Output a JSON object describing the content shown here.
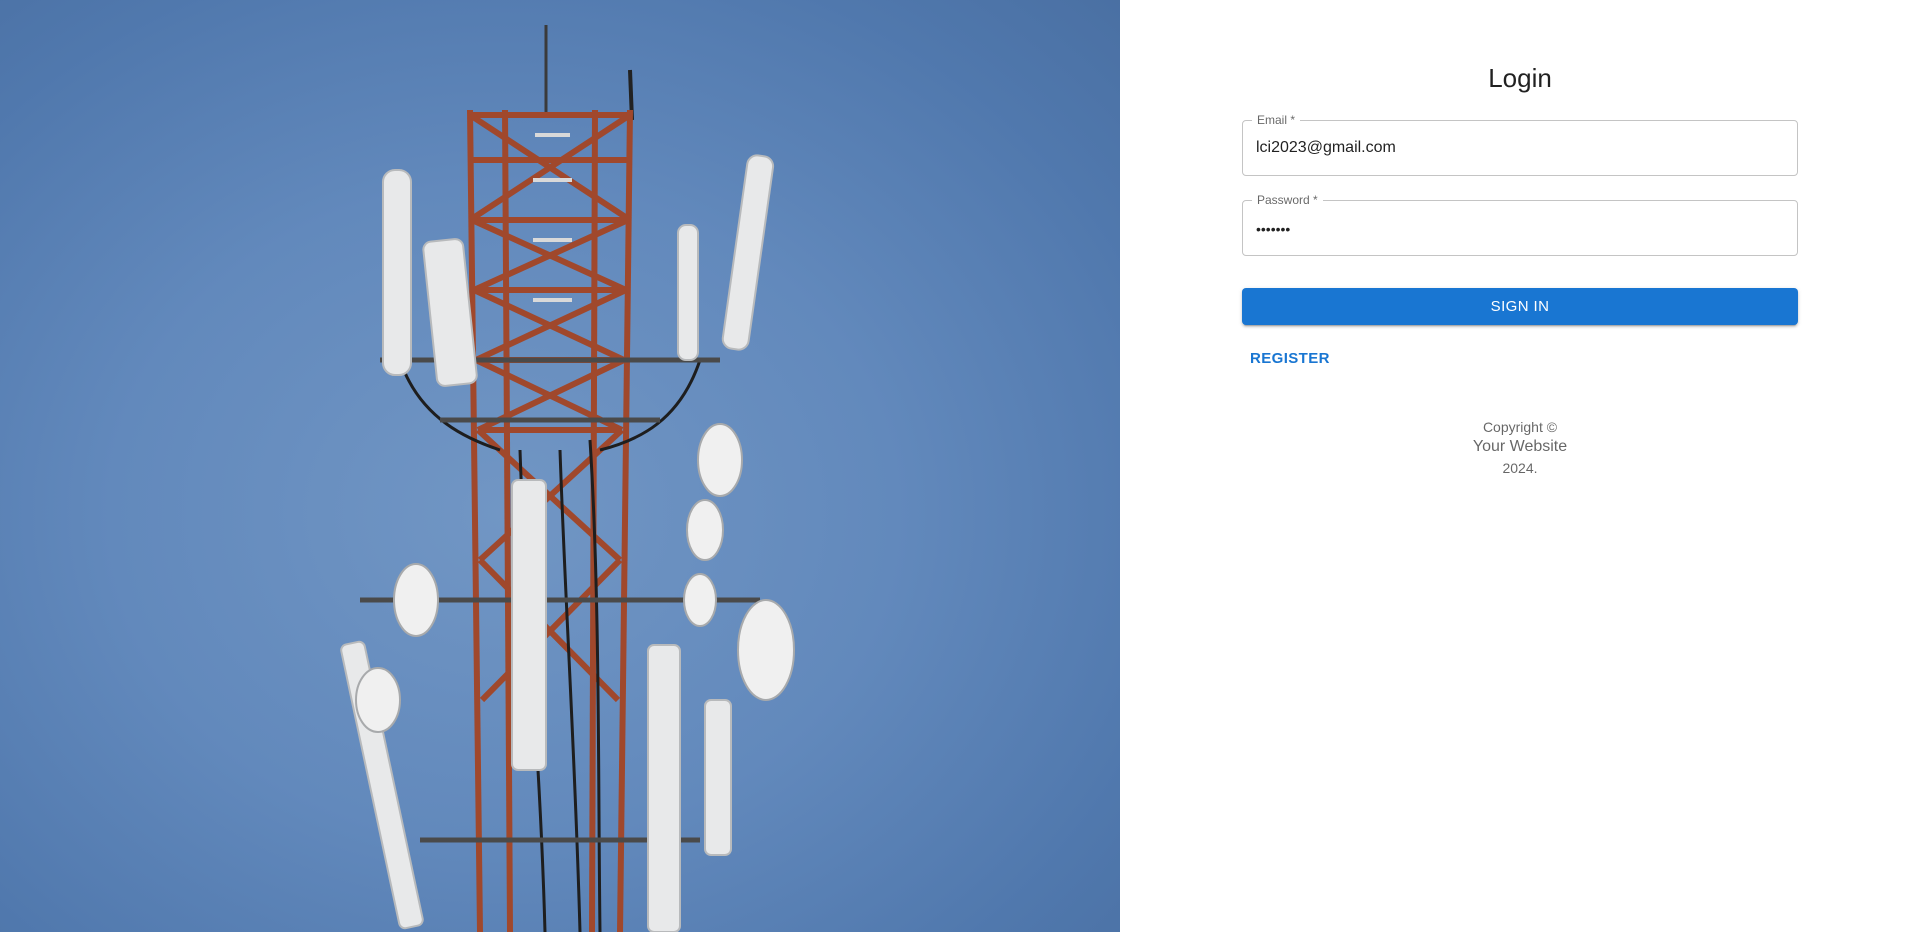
{
  "login": {
    "title": "Login",
    "email": {
      "label": "Email *",
      "value": "lci2023@gmail.com"
    },
    "password": {
      "label": "Password *",
      "value": "•••••••"
    },
    "signin_label": "SIGN IN",
    "register_label": "REGISTER"
  },
  "footer": {
    "copyright_label": "Copyright ©",
    "site_link": "Your Website",
    "year": "2024."
  },
  "colors": {
    "primary": "#1976d2",
    "sky": "#6289bc",
    "tower_red": "#a0482c",
    "tower_white": "#e8e9ea"
  },
  "hero": {
    "image": "cell-tower-photo"
  }
}
